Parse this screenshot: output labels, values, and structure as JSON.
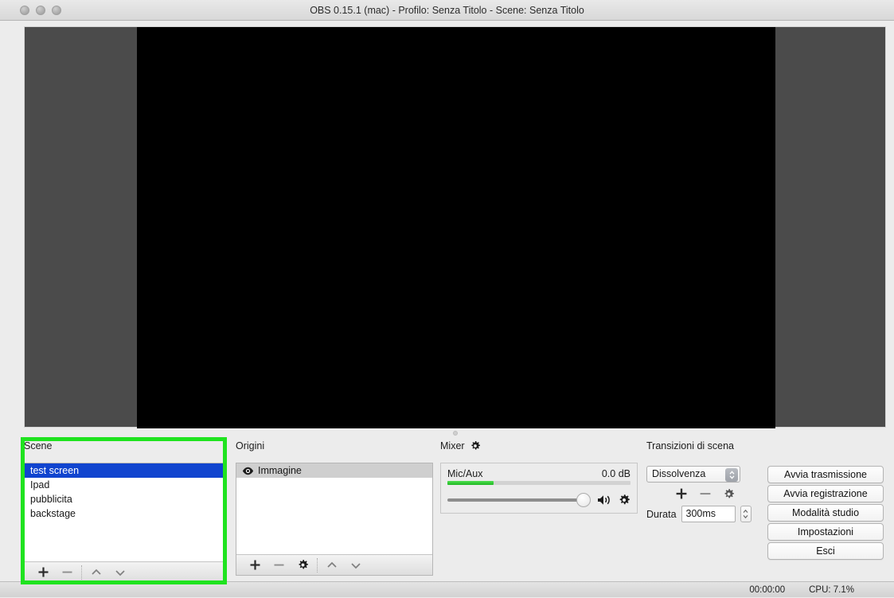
{
  "window": {
    "title": "OBS 0.15.1 (mac) - Profilo: Senza Titolo - Scene: Senza Titolo",
    "traffic_lights": [
      "close-button",
      "minimize-button",
      "maximize-button"
    ]
  },
  "preview": {
    "canvas_color": "#000000",
    "backdrop_color": "#4b4b4b",
    "name": "preview-canvas"
  },
  "highlight": {
    "color": "#1fe31f",
    "target": "scene-dock"
  },
  "scene_dock": {
    "title": "Scene",
    "items": [
      {
        "label": "test screen",
        "selected": true
      },
      {
        "label": "Ipad",
        "selected": false
      },
      {
        "label": "pubblicita",
        "selected": false
      },
      {
        "label": "backstage",
        "selected": false
      }
    ],
    "toolbar": [
      {
        "name": "add-scene-button",
        "glyph": "+"
      },
      {
        "name": "remove-scene-button",
        "glyph": "−"
      },
      {
        "name": "move-scene-up-button",
        "glyph": "∧"
      },
      {
        "name": "move-scene-down-button",
        "glyph": "∨"
      }
    ]
  },
  "sources_dock": {
    "title": "Origini",
    "items": [
      {
        "label": "Immagine",
        "visible": true,
        "shaded": true
      }
    ],
    "toolbar": [
      {
        "name": "add-source-button",
        "glyph": "+"
      },
      {
        "name": "remove-source-button",
        "glyph": "−"
      },
      {
        "name": "source-properties-button",
        "glyph": "gear"
      },
      {
        "name": "move-source-up-button",
        "glyph": "∧"
      },
      {
        "name": "move-source-down-button",
        "glyph": "∨"
      }
    ]
  },
  "mixer_dock": {
    "title": "Mixer",
    "title_icon": "gear-icon",
    "channels": [
      {
        "name": "Mic/Aux",
        "level_db": "0.0 dB",
        "meter_percent": 25,
        "volume_percent": 100,
        "mute_icon": "speaker-icon",
        "config_icon": "gear-icon"
      }
    ]
  },
  "transitions_dock": {
    "title": "Transizioni di scena",
    "selected_transition": "Dissolvenza",
    "transition_options": [
      "Dissolvenza"
    ],
    "tools": [
      {
        "name": "add-transition-button",
        "glyph": "+"
      },
      {
        "name": "remove-transition-button",
        "glyph": "−"
      },
      {
        "name": "transition-properties-button",
        "glyph": "gear"
      }
    ],
    "duration_label": "Durata",
    "duration_value": "300ms"
  },
  "controls": {
    "buttons": [
      {
        "name": "start-streaming-button",
        "label": "Avvia trasmissione"
      },
      {
        "name": "start-recording-button",
        "label": "Avvia registrazione"
      },
      {
        "name": "studio-mode-button",
        "label": "Modalità studio"
      },
      {
        "name": "settings-button",
        "label": "Impostazioni"
      },
      {
        "name": "exit-button",
        "label": "Esci"
      }
    ]
  },
  "statusbar": {
    "timecode": "00:00:00",
    "cpu": "CPU: 7.1%"
  }
}
